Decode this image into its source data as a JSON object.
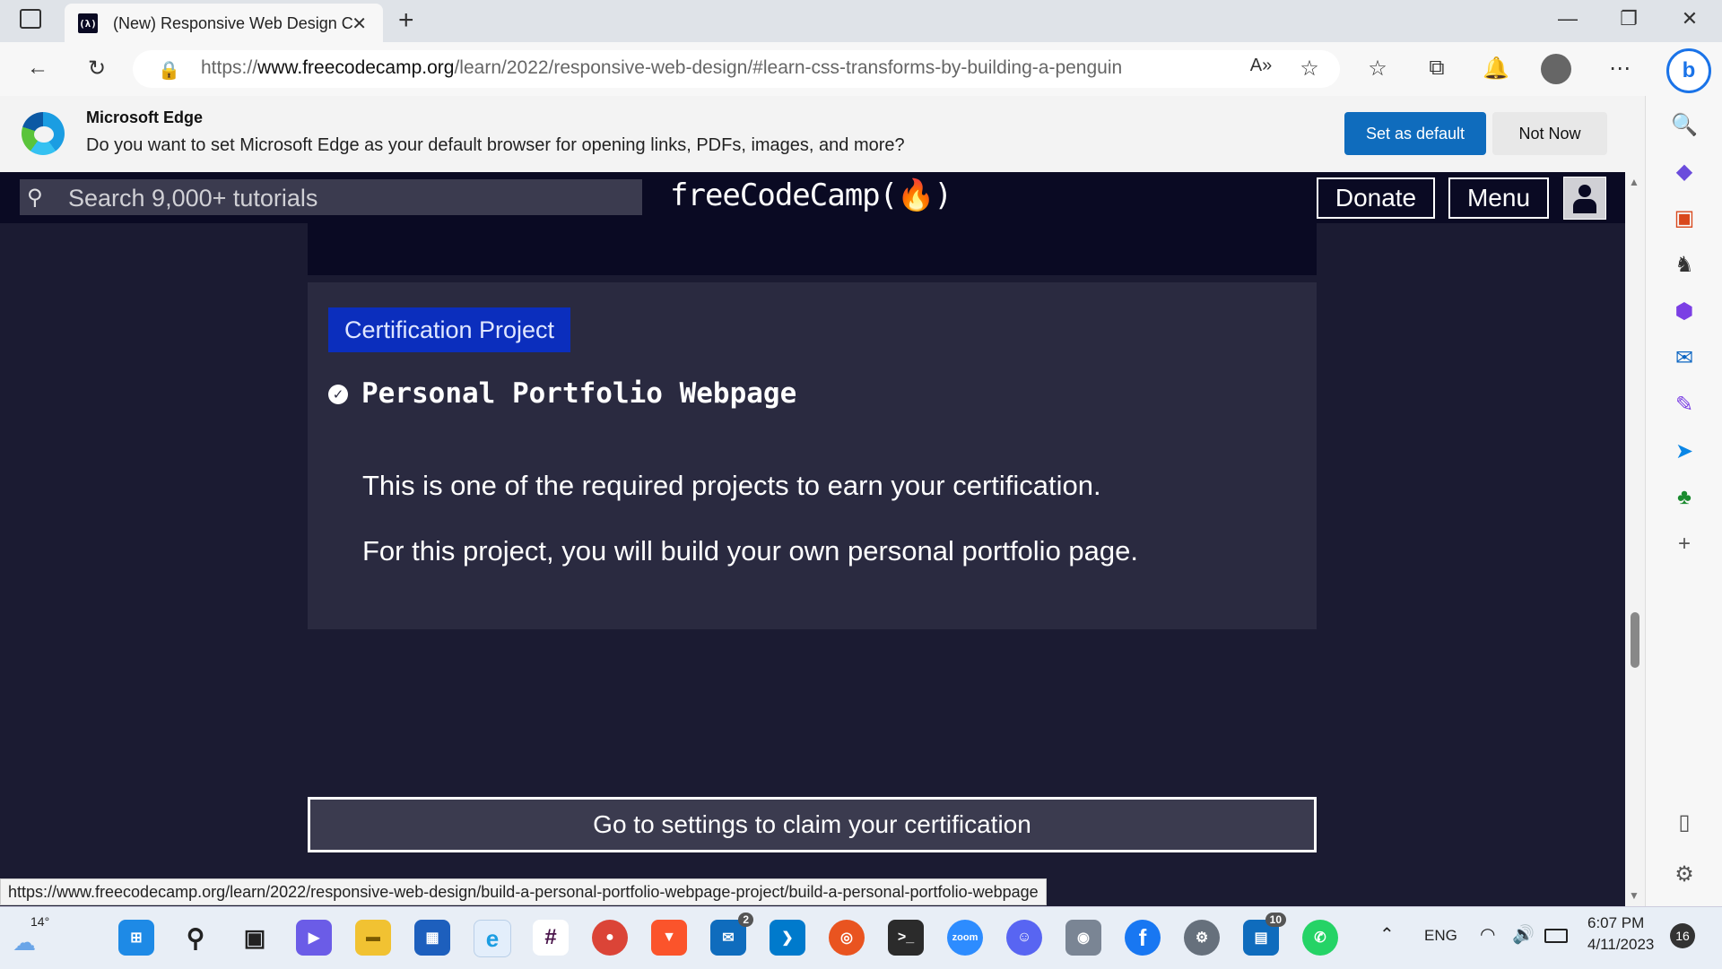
{
  "browser": {
    "tab_title": "(New) Responsive Web Design C",
    "tab_favicon": "(λ)",
    "url_prefix": "https://",
    "url_domain": "www.freecodecamp.org",
    "url_path": "/learn/2022/responsive-web-design/#learn-css-transforms-by-building-a-penguin",
    "status_url": "https://www.freecodecamp.org/learn/2022/responsive-web-design/build-a-personal-portfolio-webpage-project/build-a-personal-portfolio-webpage"
  },
  "banner": {
    "title": "Microsoft Edge",
    "message": "Do you want to set Microsoft Edge as your default browser for opening links, PDFs, images, and more?",
    "set_default_label": "Set as default",
    "not_now_label": "Not Now"
  },
  "fcc": {
    "search_placeholder": "Search 9,000+ tutorials",
    "brand": "freeCodeCamp(🔥)",
    "donate_label": "Donate",
    "menu_label": "Menu",
    "cert_badge": "Certification Project",
    "project_title": "Personal Portfolio Webpage",
    "para1": "This is one of the required projects to earn your certification.",
    "para2": "For this project, you will build your own personal portfolio page.",
    "claim_label": "Go to settings to claim your certification"
  },
  "taskbar": {
    "weather": "14°",
    "mail_badge": "2",
    "teams_badge": "10",
    "language": "ENG",
    "time": "6:07 PM",
    "date": "4/11/2023",
    "notifications": "16"
  },
  "colors": {
    "fcc_dark": "#0a0a23",
    "fcc_bg": "#1b1b32",
    "badge_blue": "#0b2ebd",
    "edge_blue": "#0f6cbd"
  }
}
